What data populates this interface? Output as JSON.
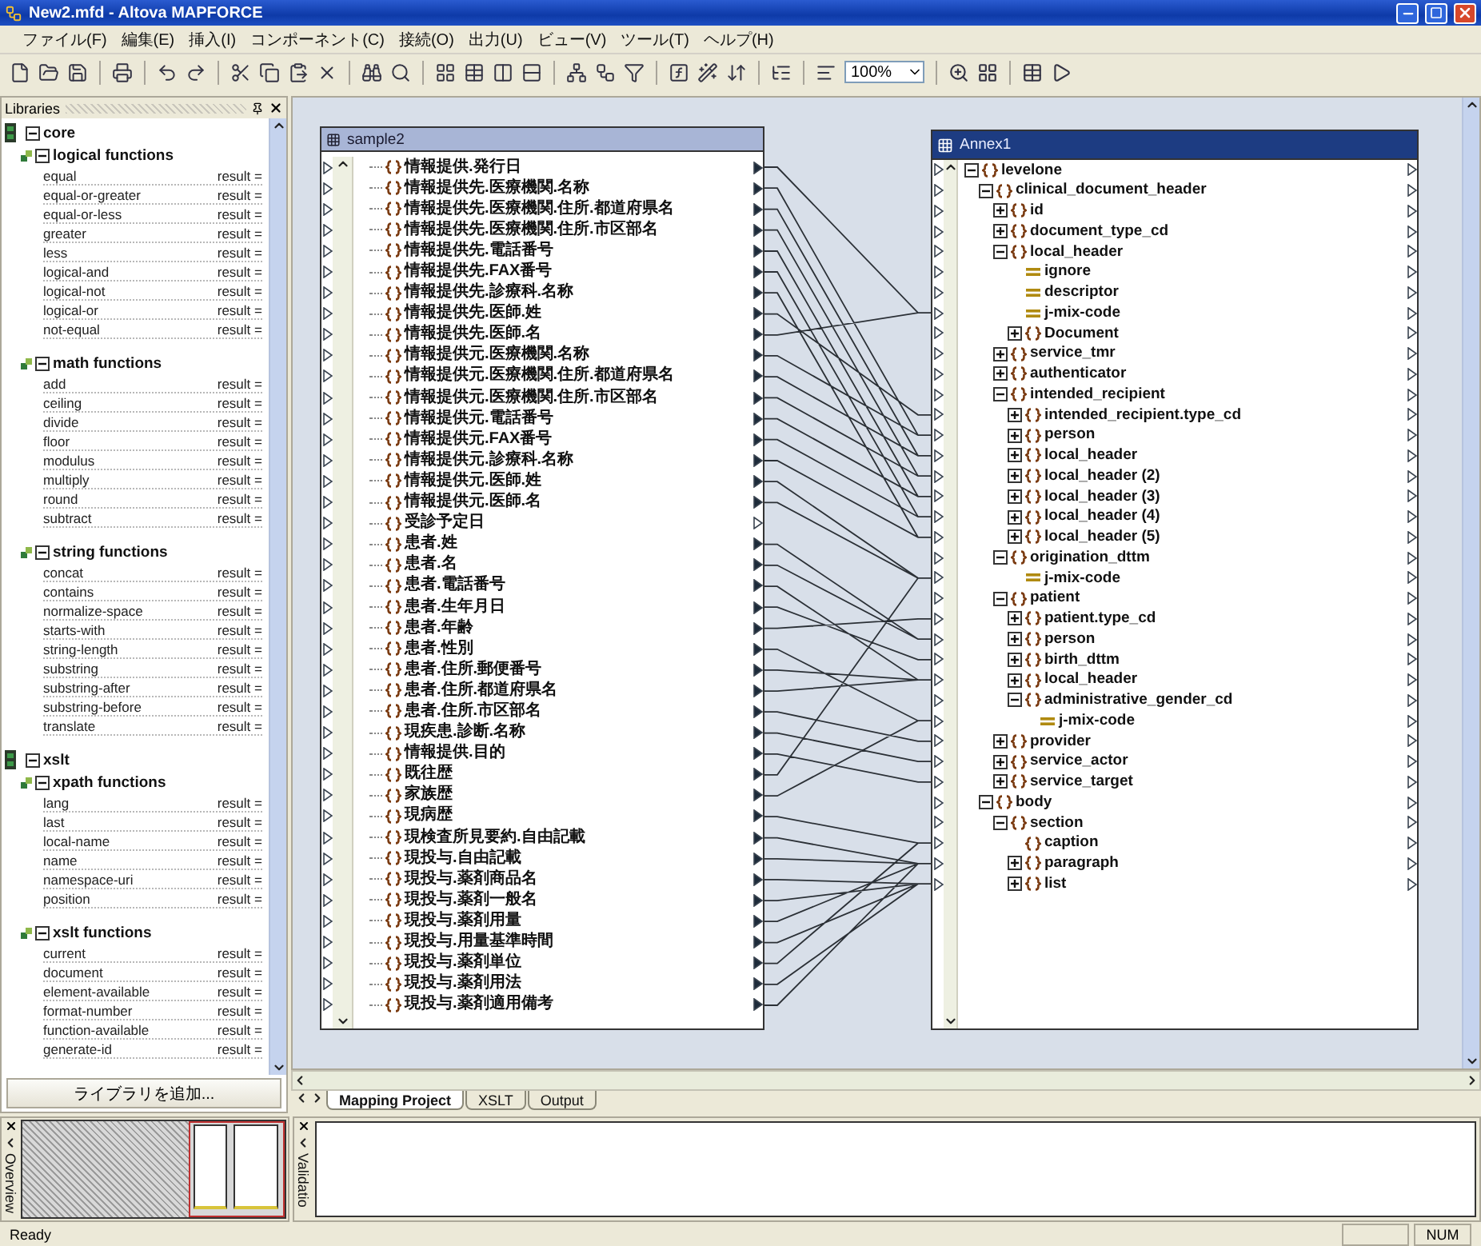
{
  "window": {
    "title": "New2.mfd - Altova MAPFORCE"
  },
  "menu": [
    "ファイル(F)",
    "編集(E)",
    "挿入(I)",
    "コンポーネント(C)",
    "接続(O)",
    "出力(U)",
    "ビュー(V)",
    "ツール(T)",
    "ヘルプ(H)"
  ],
  "toolbar": {
    "zoom": "100%"
  },
  "libraries": {
    "title": "Libraries",
    "add_button": "ライブラリを追加...",
    "items": [
      {
        "name": "core",
        "expanded": true,
        "groups": [
          {
            "name": "logical functions",
            "expanded": true,
            "functions": [
              {
                "name": "equal",
                "output": "result ="
              },
              {
                "name": "equal-or-greater",
                "output": "result ="
              },
              {
                "name": "equal-or-less",
                "output": "result ="
              },
              {
                "name": "greater",
                "output": "result ="
              },
              {
                "name": "less",
                "output": "result ="
              },
              {
                "name": "logical-and",
                "output": "result ="
              },
              {
                "name": "logical-not",
                "output": "result ="
              },
              {
                "name": "logical-or",
                "output": "result ="
              },
              {
                "name": "not-equal",
                "output": "result ="
              }
            ]
          },
          {
            "name": "math functions",
            "expanded": true,
            "functions": [
              {
                "name": "add",
                "output": "result ="
              },
              {
                "name": "ceiling",
                "output": "result ="
              },
              {
                "name": "divide",
                "output": "result ="
              },
              {
                "name": "floor",
                "output": "result ="
              },
              {
                "name": "modulus",
                "output": "result ="
              },
              {
                "name": "multiply",
                "output": "result ="
              },
              {
                "name": "round",
                "output": "result ="
              },
              {
                "name": "subtract",
                "output": "result ="
              }
            ]
          },
          {
            "name": "string functions",
            "expanded": true,
            "functions": [
              {
                "name": "concat",
                "output": "result ="
              },
              {
                "name": "contains",
                "output": "result ="
              },
              {
                "name": "normalize-space",
                "output": "result ="
              },
              {
                "name": "starts-with",
                "output": "result ="
              },
              {
                "name": "string-length",
                "output": "result ="
              },
              {
                "name": "substring",
                "output": "result ="
              },
              {
                "name": "substring-after",
                "output": "result ="
              },
              {
                "name": "substring-before",
                "output": "result ="
              },
              {
                "name": "translate",
                "output": "result ="
              }
            ]
          }
        ]
      },
      {
        "name": "xslt",
        "expanded": true,
        "groups": [
          {
            "name": "xpath functions",
            "expanded": true,
            "functions": [
              {
                "name": "lang",
                "output": "result ="
              },
              {
                "name": "last",
                "output": "result ="
              },
              {
                "name": "local-name",
                "output": "result ="
              },
              {
                "name": "name",
                "output": "result ="
              },
              {
                "name": "namespace-uri",
                "output": "result ="
              },
              {
                "name": "position",
                "output": "result ="
              }
            ]
          },
          {
            "name": "xslt functions",
            "expanded": true,
            "functions": [
              {
                "name": "current",
                "output": "result ="
              },
              {
                "name": "document",
                "output": "result ="
              },
              {
                "name": "element-available",
                "output": "result ="
              },
              {
                "name": "format-number",
                "output": "result ="
              },
              {
                "name": "function-available",
                "output": "result ="
              },
              {
                "name": "generate-id",
                "output": "result ="
              }
            ]
          }
        ]
      }
    ]
  },
  "source_component": {
    "title": "sample2",
    "active": false,
    "rows": [
      {
        "label": "情報提供.発行日",
        "linked": true
      },
      {
        "label": "情報提供先.医療機関.名称",
        "linked": true
      },
      {
        "label": "情報提供先.医療機関.住所.都道府県名",
        "linked": true
      },
      {
        "label": "情報提供先.医療機関.住所.市区部名",
        "linked": true
      },
      {
        "label": "情報提供先.電話番号",
        "linked": true
      },
      {
        "label": "情報提供先.FAX番号",
        "linked": true
      },
      {
        "label": "情報提供先.診療科.名称",
        "linked": true
      },
      {
        "label": "情報提供先.医師.姓",
        "linked": true
      },
      {
        "label": "情報提供先.医師.名",
        "linked": true
      },
      {
        "label": "情報提供元.医療機関.名称",
        "linked": true
      },
      {
        "label": "情報提供元.医療機関.住所.都道府県名",
        "linked": true
      },
      {
        "label": "情報提供元.医療機関.住所.市区部名",
        "linked": true
      },
      {
        "label": "情報提供元.電話番号",
        "linked": true
      },
      {
        "label": "情報提供元.FAX番号",
        "linked": true
      },
      {
        "label": "情報提供元.診療科.名称",
        "linked": true
      },
      {
        "label": "情報提供元.医師.姓",
        "linked": true
      },
      {
        "label": "情報提供元.医師.名",
        "linked": true
      },
      {
        "label": "受診予定日",
        "linked": false
      },
      {
        "label": "患者.姓",
        "linked": true
      },
      {
        "label": "患者.名",
        "linked": true
      },
      {
        "label": "患者.電話番号",
        "linked": true
      },
      {
        "label": "患者.生年月日",
        "linked": true
      },
      {
        "label": "患者.年齢",
        "linked": true
      },
      {
        "label": "患者.性別",
        "linked": true
      },
      {
        "label": "患者.住所.郵便番号",
        "linked": true
      },
      {
        "label": "患者.住所.都道府県名",
        "linked": true
      },
      {
        "label": "患者.住所.市区部名",
        "linked": true
      },
      {
        "label": "現疾患.診断.名称",
        "linked": true
      },
      {
        "label": "情報提供.目的",
        "linked": true
      },
      {
        "label": "既往歴",
        "linked": true
      },
      {
        "label": "家族歴",
        "linked": true
      },
      {
        "label": "現病歴",
        "linked": true
      },
      {
        "label": "現検査所見要約.自由記載",
        "linked": true
      },
      {
        "label": "現投与.自由記載",
        "linked": true
      },
      {
        "label": "現投与.薬剤商品名",
        "linked": true
      },
      {
        "label": "現投与.薬剤一般名",
        "linked": true
      },
      {
        "label": "現投与.薬剤用量",
        "linked": true
      },
      {
        "label": "現投与.用量基準時間",
        "linked": true
      },
      {
        "label": "現投与.薬剤単位",
        "linked": true
      },
      {
        "label": "現投与.薬剤用法",
        "linked": true
      },
      {
        "label": "現投与.薬剤適用備考",
        "linked": true
      }
    ]
  },
  "target_component": {
    "title": "Annex1",
    "active": true,
    "tree": [
      {
        "label": "levelone",
        "kind": "element",
        "expanded": true,
        "children": [
          {
            "label": "clinical_document_header",
            "kind": "element",
            "expanded": true,
            "children": [
              {
                "label": "id",
                "kind": "element",
                "expanded": false
              },
              {
                "label": "document_type_cd",
                "kind": "element",
                "expanded": false
              },
              {
                "label": "local_header",
                "kind": "element",
                "expanded": true,
                "children": [
                  {
                    "label": "ignore",
                    "kind": "attribute"
                  },
                  {
                    "label": "descriptor",
                    "kind": "attribute"
                  },
                  {
                    "label": "j-mix-code",
                    "kind": "attribute"
                  },
                  {
                    "label": "Document",
                    "kind": "element",
                    "expanded": false
                  }
                ]
              },
              {
                "label": "service_tmr",
                "kind": "element",
                "expanded": false
              },
              {
                "label": "authenticator",
                "kind": "element",
                "expanded": false
              },
              {
                "label": "intended_recipient",
                "kind": "element",
                "expanded": true,
                "children": [
                  {
                    "label": "intended_recipient.type_cd",
                    "kind": "element",
                    "expanded": false
                  },
                  {
                    "label": "person",
                    "kind": "element",
                    "expanded": false
                  },
                  {
                    "label": "local_header",
                    "kind": "element",
                    "expanded": false
                  },
                  {
                    "label": "local_header (2)",
                    "kind": "element",
                    "expanded": false
                  },
                  {
                    "label": "local_header (3)",
                    "kind": "element",
                    "expanded": false
                  },
                  {
                    "label": "local_header (4)",
                    "kind": "element",
                    "expanded": false
                  },
                  {
                    "label": "local_header (5)",
                    "kind": "element",
                    "expanded": false
                  }
                ]
              },
              {
                "label": "origination_dttm",
                "kind": "element",
                "expanded": true,
                "children": [
                  {
                    "label": "j-mix-code",
                    "kind": "attribute"
                  }
                ]
              },
              {
                "label": "patient",
                "kind": "element",
                "expanded": true,
                "children": [
                  {
                    "label": "patient.type_cd",
                    "kind": "element",
                    "expanded": false
                  },
                  {
                    "label": "person",
                    "kind": "element",
                    "expanded": false
                  },
                  {
                    "label": "birth_dttm",
                    "kind": "element",
                    "expanded": false
                  },
                  {
                    "label": "local_header",
                    "kind": "element",
                    "expanded": false
                  },
                  {
                    "label": "administrative_gender_cd",
                    "kind": "element",
                    "expanded": true,
                    "children": [
                      {
                        "label": "j-mix-code",
                        "kind": "attribute"
                      }
                    ]
                  }
                ]
              },
              {
                "label": "provider",
                "kind": "element",
                "expanded": false
              },
              {
                "label": "service_actor",
                "kind": "element",
                "expanded": false
              },
              {
                "label": "service_target",
                "kind": "element",
                "expanded": false
              }
            ]
          },
          {
            "label": "body",
            "kind": "element",
            "expanded": true,
            "children": [
              {
                "label": "section",
                "kind": "element",
                "expanded": true,
                "children": [
                  {
                    "label": "caption",
                    "kind": "leaf"
                  },
                  {
                    "label": "paragraph",
                    "kind": "element",
                    "expanded": false
                  },
                  {
                    "label": "list",
                    "kind": "element",
                    "expanded": false
                  }
                ]
              }
            ]
          }
        ]
      }
    ]
  },
  "tabs": [
    {
      "label": "Mapping Project",
      "selected": true
    },
    {
      "label": "XSLT",
      "selected": false
    },
    {
      "label": "Output",
      "selected": false
    }
  ],
  "overview": {
    "label": "Overview"
  },
  "validation": {
    "label": "Validatio"
  },
  "status_bar": {
    "message": "Ready",
    "indicators": [
      "NUM"
    ]
  }
}
